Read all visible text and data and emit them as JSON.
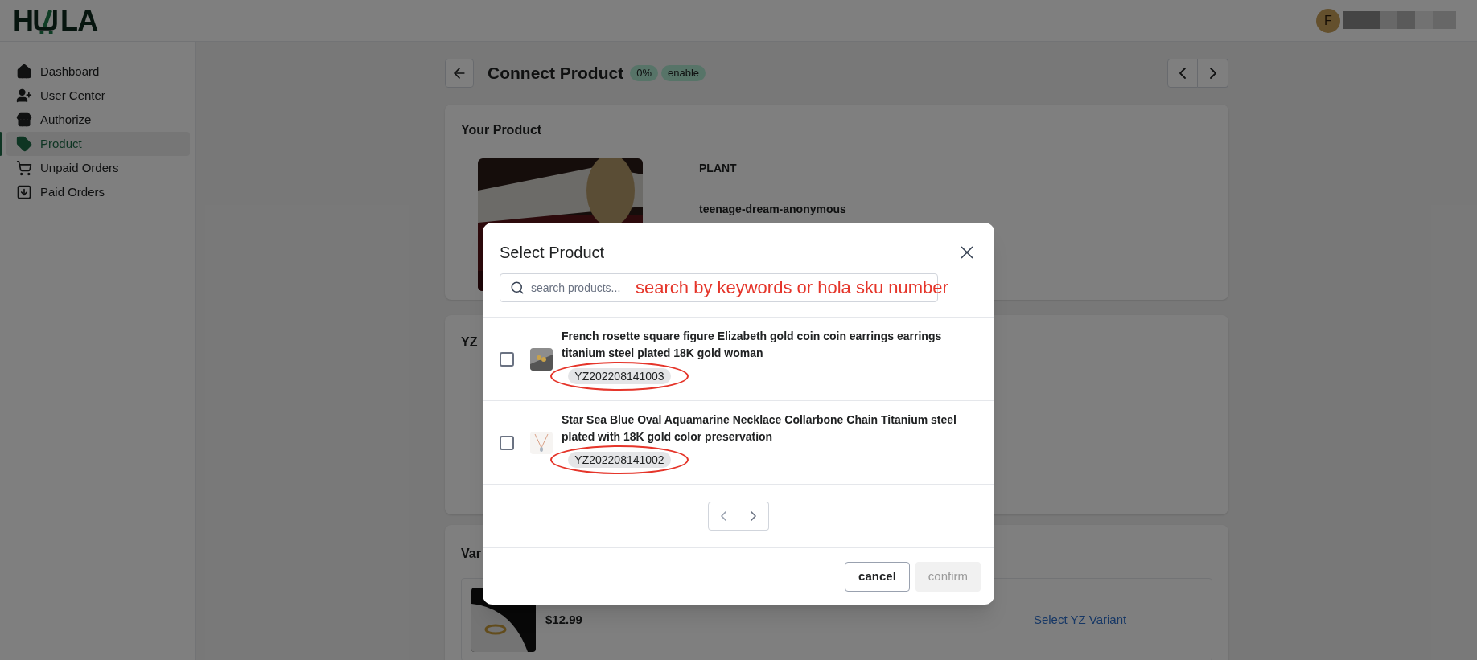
{
  "logo": {
    "before": "H",
    "after": "LA"
  },
  "header": {
    "avatar": "F"
  },
  "sidebar": {
    "items": [
      {
        "label": "Dashboard",
        "selected": false
      },
      {
        "label": "User Center",
        "selected": false
      },
      {
        "label": "Authorize",
        "selected": false
      },
      {
        "label": "Product",
        "selected": true
      },
      {
        "label": "Unpaid Orders",
        "selected": false
      },
      {
        "label": "Paid Orders",
        "selected": false
      }
    ]
  },
  "page": {
    "title": "Connect Product",
    "badges": [
      "0%",
      "enable"
    ]
  },
  "your_product": {
    "title": "Your Product",
    "name": "PLANT",
    "vendor": "teenage-dream-anonymous"
  },
  "yz_card": {
    "title": "YZ"
  },
  "variants_card": {
    "title": "Var",
    "variants": [
      {
        "price": "$12.99",
        "link": "Select YZ Variant"
      }
    ]
  },
  "modal": {
    "title": "Select Product",
    "search": {
      "placeholder": "search products..."
    },
    "annotation": "search by keywords or hola sku number",
    "products": [
      {
        "name": "French rosette square figure Elizabeth gold coin coin earrings earrings titanium steel plated 18K gold woman",
        "sku": "YZ202208141003",
        "checked": false
      },
      {
        "name": "Star Sea Blue Oval Aquamarine Necklace Collarbone Chain Titanium steel plated with 18K gold color preservation",
        "sku": "YZ202208141002",
        "checked": false
      }
    ],
    "buttons": [
      {
        "label": "cancel",
        "disabled": false
      },
      {
        "label": "confirm",
        "disabled": true
      }
    ]
  }
}
